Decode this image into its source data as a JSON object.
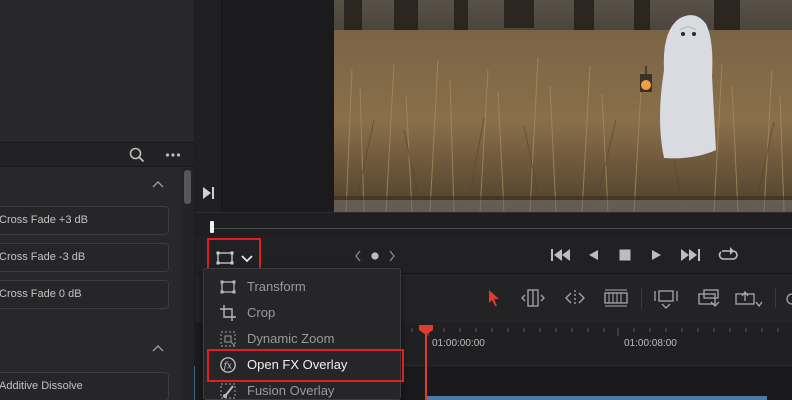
{
  "left_panel": {
    "effects": [
      {
        "label": "Cross Fade +3 dB"
      },
      {
        "label": "Cross Fade -3 dB"
      },
      {
        "label": "Cross Fade 0 dB"
      },
      {
        "label": "Additive Dissolve"
      }
    ]
  },
  "viewer": {
    "overlay_dropdown_selected": "rectangle-overlay-icon"
  },
  "menu": {
    "items": [
      {
        "label": "Transform",
        "icon": "transform-icon"
      },
      {
        "label": "Crop",
        "icon": "crop-icon"
      },
      {
        "label": "Dynamic Zoom",
        "icon": "dynamic-zoom-icon"
      },
      {
        "label": "Open FX Overlay",
        "icon": "fx-icon"
      },
      {
        "label": "Fusion Overlay",
        "icon": "fusion-brush-icon"
      }
    ]
  },
  "timeline": {
    "timecodes": [
      "01:00:00:00",
      "01:00:08:00"
    ]
  },
  "colors": {
    "playhead": "#e03c2e",
    "highlight": "#e02020",
    "clip": "#4a7aa8"
  }
}
